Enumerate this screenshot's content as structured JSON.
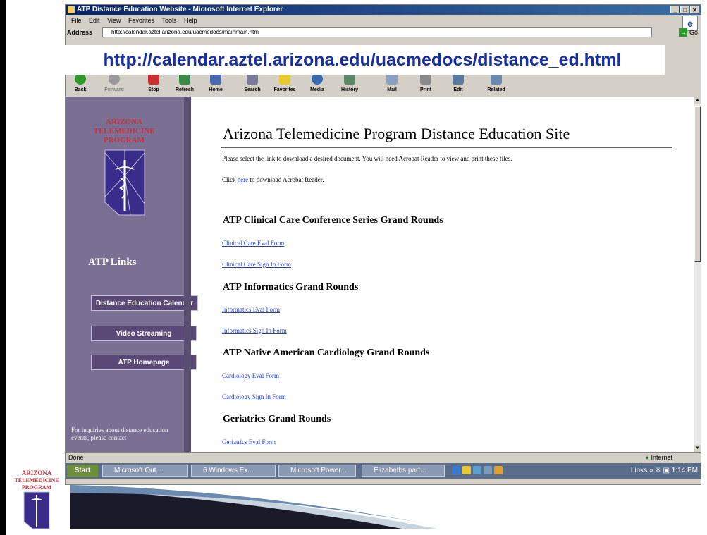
{
  "window": {
    "title": "ATP Distance Education Website - Microsoft Internet Explorer",
    "menu": [
      "File",
      "Edit",
      "View",
      "Favorites",
      "Tools",
      "Help"
    ],
    "address_label": "Address",
    "address_value": "http://calendar.aztel.arizona.edu/uacmedocs/mainmain.htm",
    "go_label": "Go",
    "toolbar": [
      "Back",
      "Forward",
      "Stop",
      "Refresh",
      "Home",
      "Search",
      "Favorites",
      "Media",
      "History",
      "Mail",
      "Print",
      "Edit",
      "Related"
    ]
  },
  "url_overlay": "http://calendar.aztel.arizona.edu/uacmedocs/distance_ed.html",
  "sidebar": {
    "logo_lines": [
      "ARIZONA",
      "TELEMEDICINE",
      "PROGRAM"
    ],
    "links_heading": "ATP Links",
    "buttons": [
      "Distance Education Calendar",
      "Video Streaming",
      "ATP Homepage"
    ],
    "footer": "For inquiries about distance education events, please contact"
  },
  "main": {
    "title": "Arizona Telemedicine Program Distance Education Site",
    "intro": "Please select the link to download a desired document. You will need Acrobat Reader to view and print these files.",
    "acrobat_prefix": "Click ",
    "acrobat_link": "here",
    "acrobat_suffix": " to download Acrobat Reader.",
    "sections": [
      {
        "heading": "ATP Clinical Care Conference Series Grand Rounds",
        "links": [
          "Clinical Care Eval Form",
          "Clinical Care Sign In Form"
        ]
      },
      {
        "heading": "ATP Informatics Grand Rounds",
        "links": [
          "Informatics Eval Form",
          "Informatics Sign In Form"
        ]
      },
      {
        "heading": "ATP Native American Cardiology Grand Rounds",
        "links": [
          "Cardiology Eval Form",
          "Cardiology Sign In Form"
        ]
      },
      {
        "heading": "Geriatrics Grand Rounds",
        "links": [
          "Geriatrics Eval Form"
        ]
      }
    ]
  },
  "status": {
    "left": "Done",
    "zone": "Internet"
  },
  "taskbar": {
    "start": "Start",
    "buttons": [
      "Microsoft Out...",
      "6 Windows Ex...",
      "Microsoft Power...",
      "Elizabeths part..."
    ],
    "links_label": "Links",
    "clock": "1:14 PM"
  },
  "colors": {
    "sidebar": "#7b6f94",
    "link": "#2a3fc0",
    "url_overlay": "#1a2f9f",
    "titlebar": "#0a246a"
  }
}
